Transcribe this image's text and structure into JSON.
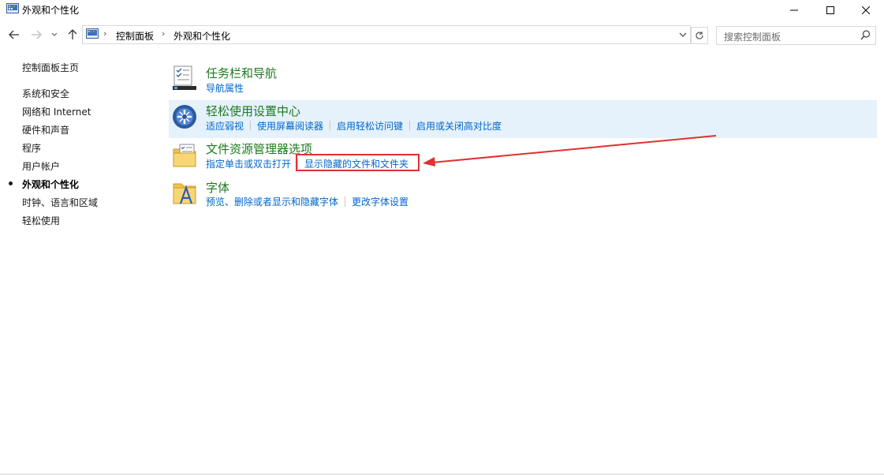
{
  "window": {
    "title": "外观和个性化",
    "controls": [
      "minimize-icon",
      "maximize-icon",
      "close-icon"
    ]
  },
  "nav": {
    "back_icon": "arrow-left-icon",
    "forward_icon": "arrow-right-icon",
    "recent_icon": "chevron-down-icon",
    "up_icon": "arrow-up-icon",
    "breadcrumb": [
      "控制面板",
      "外观和个性化"
    ],
    "refresh_icon": "refresh-icon",
    "search_placeholder": "搜索控制面板"
  },
  "sidebar": {
    "home": "控制面板主页",
    "items": [
      {
        "label": "系统和安全",
        "current": false
      },
      {
        "label": "网络和 Internet",
        "current": false
      },
      {
        "label": "硬件和声音",
        "current": false
      },
      {
        "label": "程序",
        "current": false
      },
      {
        "label": "用户帐户",
        "current": false
      },
      {
        "label": "外观和个性化",
        "current": true
      },
      {
        "label": "时钟、语言和区域",
        "current": false
      },
      {
        "label": "轻松使用",
        "current": false
      }
    ]
  },
  "categories": [
    {
      "title": "任务栏和导航",
      "icon": "taskbar-icon",
      "links": [
        "导航属性"
      ]
    },
    {
      "title": "轻松使用设置中心",
      "icon": "ease-of-access-icon",
      "highlighted": true,
      "links": [
        "适应弱视",
        "使用屏幕阅读器",
        "启用轻松访问键",
        "启用或关闭高对比度"
      ]
    },
    {
      "title": "文件资源管理器选项",
      "icon": "folder-options-icon",
      "links": [
        "指定单击或双击打开",
        "显示隐藏的文件和文件夹"
      ]
    },
    {
      "title": "字体",
      "icon": "fonts-icon",
      "links": [
        "预览、删除或者显示和隐藏字体",
        "更改字体设置"
      ]
    }
  ],
  "annotation": {
    "highlight_color": "#e03030",
    "target": "显示隐藏的文件和文件夹"
  },
  "colors": {
    "category_title": "#1e7a1e",
    "link": "#0066cc",
    "highlight_row": "#e5f1fb"
  }
}
